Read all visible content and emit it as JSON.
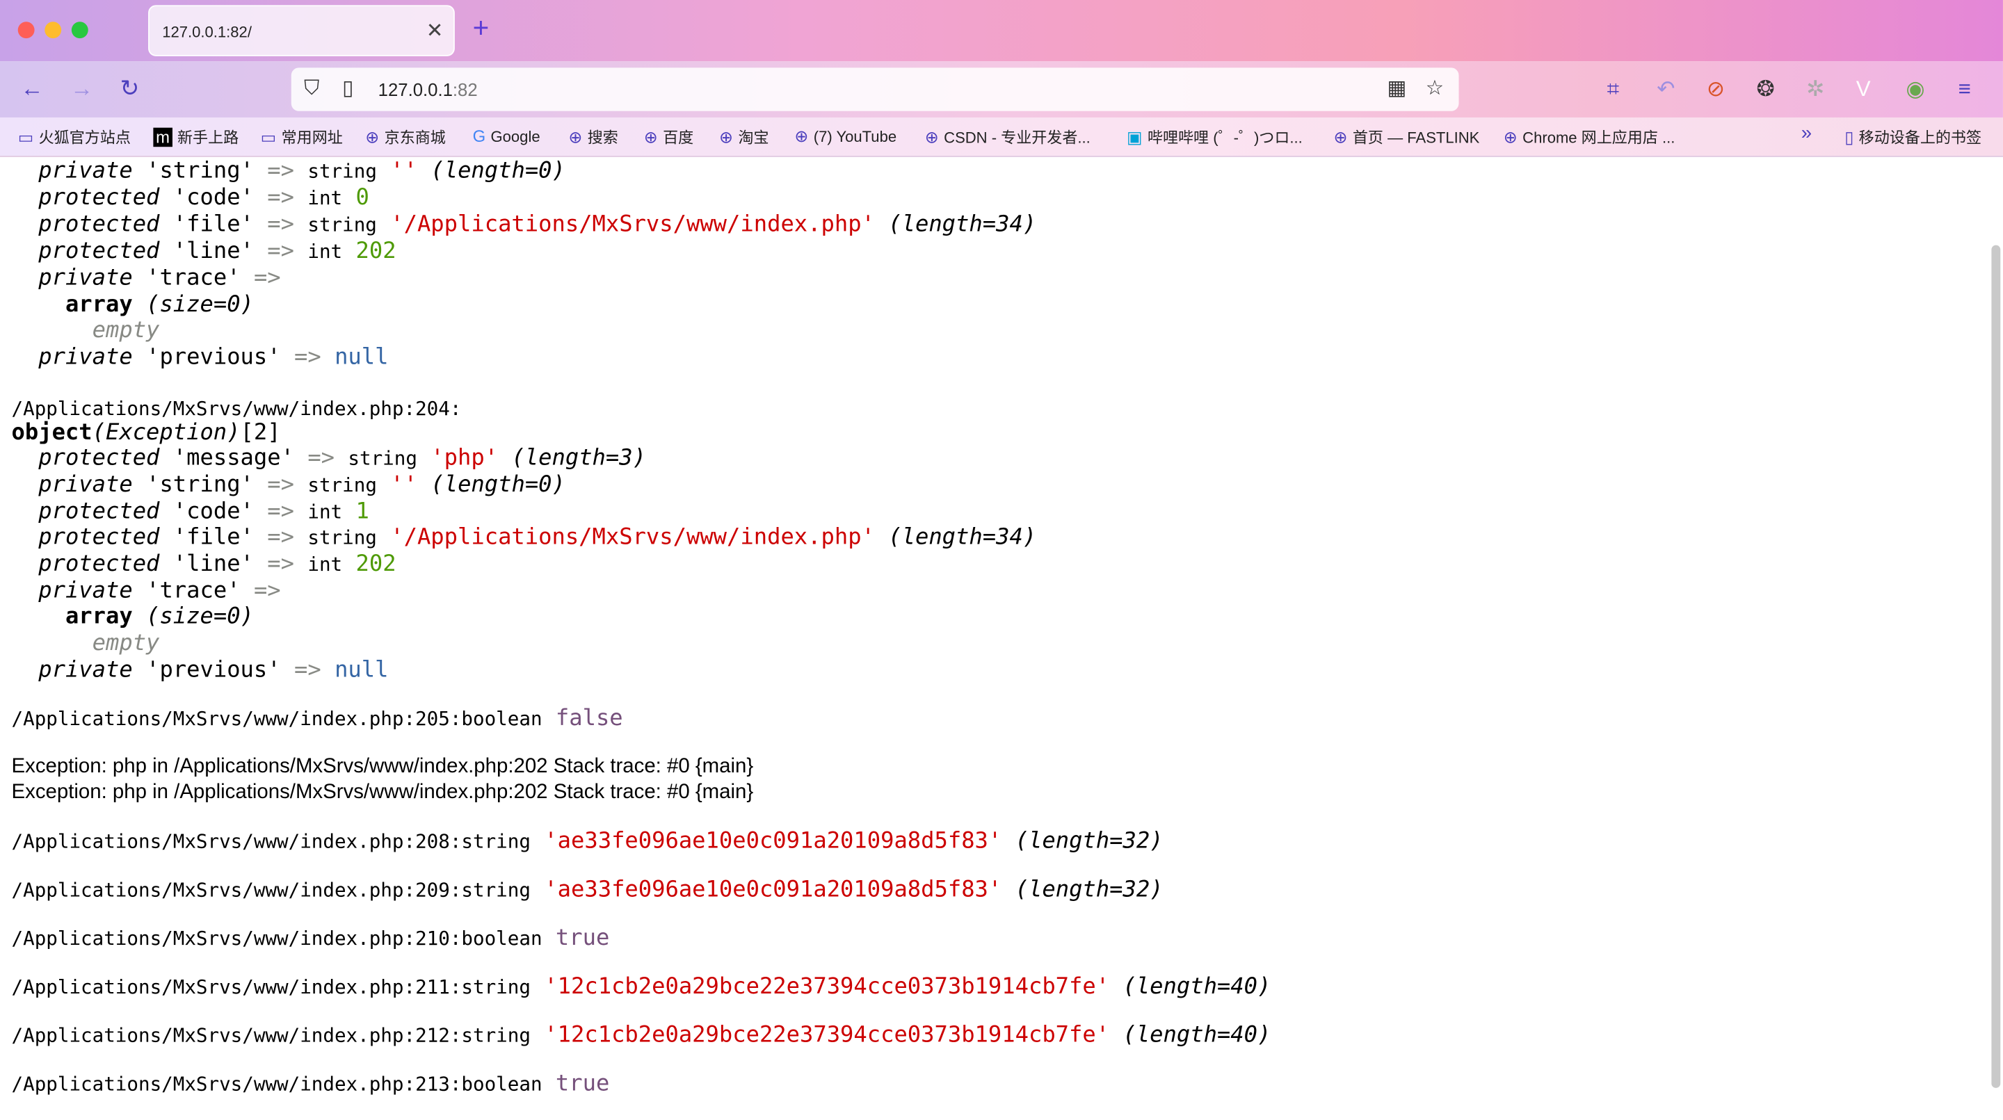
{
  "browser": {
    "tab_title": "127.0.0.1:82/",
    "url_host": "127.0.0.1",
    "url_port": ":82"
  },
  "bookmarks": [
    {
      "icon": "folder-icon",
      "label": "火狐官方站点"
    },
    {
      "icon": "m-logo-icon",
      "label": "新手上路"
    },
    {
      "icon": "folder-icon",
      "label": "常用网址"
    },
    {
      "icon": "globe-icon",
      "label": "京东商城"
    },
    {
      "icon": "google-icon",
      "label": "Google"
    },
    {
      "icon": "globe-icon",
      "label": "搜索"
    },
    {
      "icon": "globe-icon",
      "label": "百度"
    },
    {
      "icon": "globe-icon",
      "label": "淘宝"
    },
    {
      "icon": "globe-icon",
      "label": "(7) YouTube"
    },
    {
      "icon": "globe-icon",
      "label": "CSDN - 专业开发者..."
    },
    {
      "icon": "bilibili-icon",
      "label": "哔哩哔哩 (゜-゜)つロ..."
    },
    {
      "icon": "globe-icon",
      "label": "首页 — FASTLINK"
    },
    {
      "icon": "globe-icon",
      "label": "Chrome 网上应用店 ..."
    }
  ],
  "mobile_bookmarks": "移动设备上的书签",
  "dump": {
    "b1": {
      "string_line": {
        "vis": "private",
        "key": "'string'",
        "type": "string",
        "val": "''",
        "len": "(length=0)"
      },
      "code_line": {
        "vis": "protected",
        "key": "'code'",
        "type": "int",
        "val": "0"
      },
      "file_line": {
        "vis": "protected",
        "key": "'file'",
        "type": "string",
        "val": "'/Applications/MxSrvs/www/index.php'",
        "len": "(length=34)"
      },
      "line_line": {
        "vis": "protected",
        "key": "'line'",
        "type": "int",
        "val": "202"
      },
      "trace_line": {
        "vis": "private",
        "key": "'trace'"
      },
      "array": "array",
      "array_size": "(size=0)",
      "empty": "empty",
      "prev_line": {
        "vis": "private",
        "key": "'previous'",
        "val": "null"
      }
    },
    "path204": "/Applications/MxSrvs/www/index.php:204:",
    "obj_kw": "object",
    "obj_class": "(Exception)",
    "obj_id": "[2]",
    "b2": {
      "msg_line": {
        "vis": "protected",
        "key": "'message'",
        "type": "string",
        "val": "'php'",
        "len": "(length=3)"
      },
      "string_line": {
        "vis": "private",
        "key": "'string'",
        "type": "string",
        "val": "''",
        "len": "(length=0)"
      },
      "code_line": {
        "vis": "protected",
        "key": "'code'",
        "type": "int",
        "val": "1"
      },
      "file_line": {
        "vis": "protected",
        "key": "'file'",
        "type": "string",
        "val": "'/Applications/MxSrvs/www/index.php'",
        "len": "(length=34)"
      },
      "line_line": {
        "vis": "protected",
        "key": "'line'",
        "type": "int",
        "val": "202"
      },
      "trace_line": {
        "vis": "private",
        "key": "'trace'"
      },
      "array": "array",
      "array_size": "(size=0)",
      "empty": "empty",
      "prev_line": {
        "vis": "private",
        "key": "'previous'",
        "val": "null"
      }
    },
    "arrow": "=>",
    "l205": {
      "path": "/Applications/MxSrvs/www/index.php:205:",
      "type": "boolean",
      "val": "false"
    },
    "exc1": "Exception: php in /Applications/MxSrvs/www/index.php:202 Stack trace: #0 {main}",
    "exc2": "Exception: php in /Applications/MxSrvs/www/index.php:202 Stack trace: #0 {main}",
    "l208": {
      "path": "/Applications/MxSrvs/www/index.php:208:",
      "type": "string",
      "val": "'ae33fe096ae10e0c091a20109a8d5f83'",
      "len": "(length=32)"
    },
    "l209": {
      "path": "/Applications/MxSrvs/www/index.php:209:",
      "type": "string",
      "val": "'ae33fe096ae10e0c091a20109a8d5f83'",
      "len": "(length=32)"
    },
    "l210": {
      "path": "/Applications/MxSrvs/www/index.php:210:",
      "type": "boolean",
      "val": "true"
    },
    "l211": {
      "path": "/Applications/MxSrvs/www/index.php:211:",
      "type": "string",
      "val": "'12c1cb2e0a29bce22e37394cce0373b1914cb7fe'",
      "len": "(length=40)"
    },
    "l212": {
      "path": "/Applications/MxSrvs/www/index.php:212:",
      "type": "string",
      "val": "'12c1cb2e0a29bce22e37394cce0373b1914cb7fe'",
      "len": "(length=40)"
    },
    "l213": {
      "path": "/Applications/MxSrvs/www/index.php:213:",
      "type": "boolean",
      "val": "true"
    }
  }
}
